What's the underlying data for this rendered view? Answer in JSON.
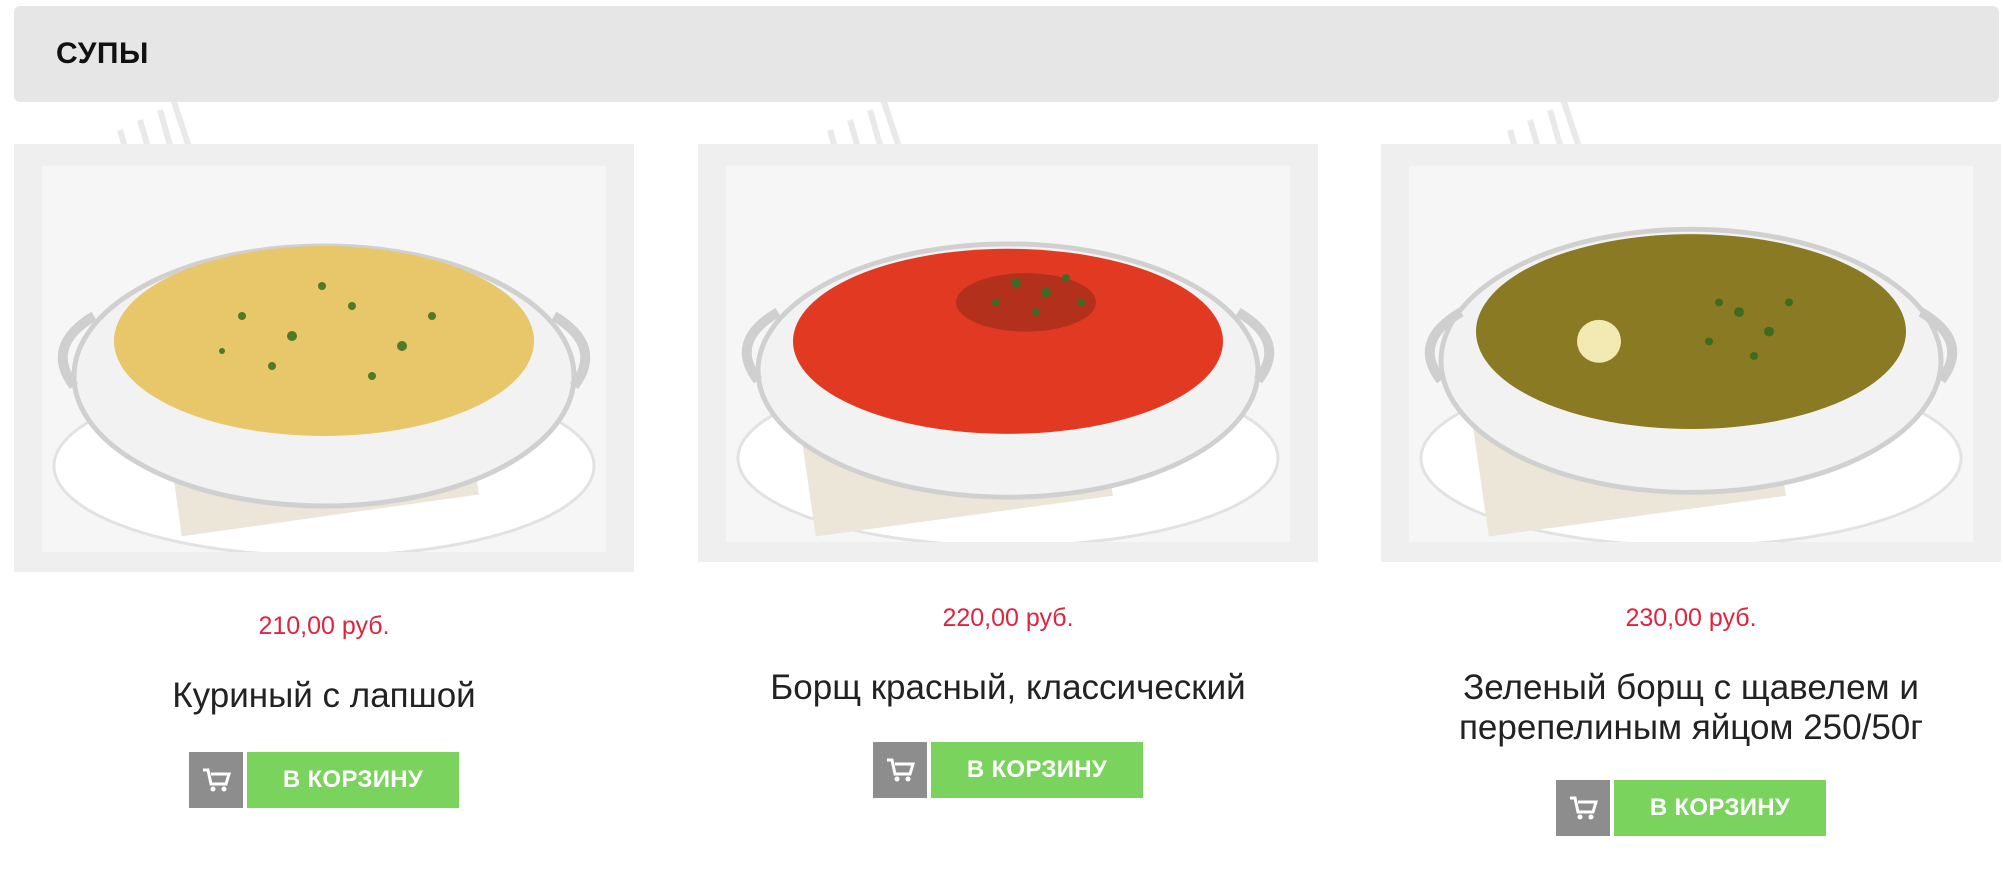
{
  "category": {
    "title": "СУПЫ"
  },
  "products": [
    {
      "price": "210,00 руб.",
      "name": "Куриный с лапшой",
      "cart_label": "В КОРЗИНУ",
      "soup_color": "#e8c76a"
    },
    {
      "price": "220,00 руб.",
      "name": "Борщ красный, классический",
      "cart_label": "В КОРЗИНУ",
      "soup_color": "#e23a22"
    },
    {
      "price": "230,00 руб.",
      "name": "Зеленый борщ с щавелем и перепелиным яйцом 250/50г",
      "cart_label": "В КОРЗИНУ",
      "soup_color": "#8a7a24"
    }
  ],
  "colors": {
    "price": "#e0243f",
    "cart_button": "#79d35d",
    "cart_icon_button": "#8d8d8d",
    "category_bar": "#e6e6e6"
  },
  "icons": {
    "cart": "cart-icon"
  }
}
